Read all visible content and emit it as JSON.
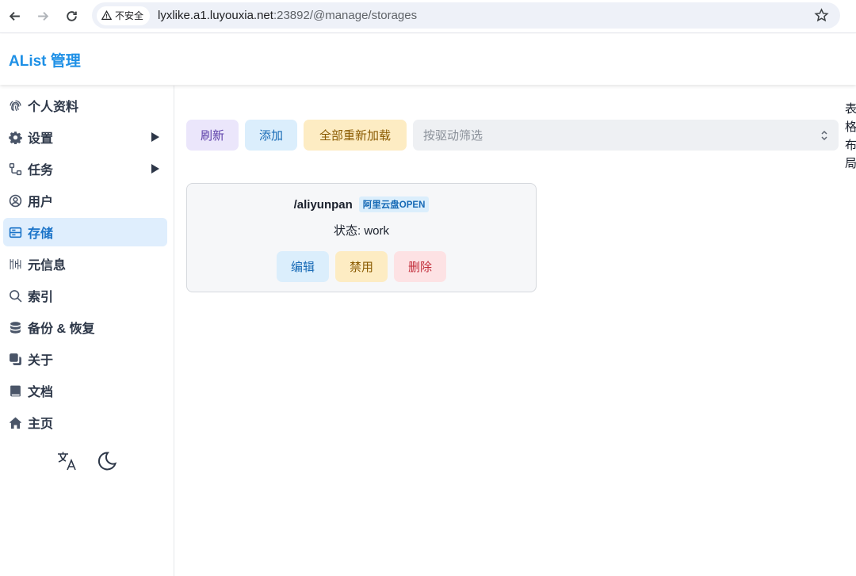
{
  "browser": {
    "security_label": "不安全",
    "url_host": "lyxlike.a1.luyouxia.net",
    "url_path": ":23892/@manage/storages"
  },
  "header": {
    "title": "AList 管理"
  },
  "sidebar": {
    "items": [
      {
        "label": "个人资料",
        "icon": "fingerprint-icon",
        "active": false,
        "expandable": false
      },
      {
        "label": "设置",
        "icon": "gear-icon",
        "active": false,
        "expandable": true
      },
      {
        "label": "任务",
        "icon": "workflow-icon",
        "active": false,
        "expandable": true
      },
      {
        "label": "用户",
        "icon": "user-circle-icon",
        "active": false,
        "expandable": false
      },
      {
        "label": "存储",
        "icon": "storage-icon",
        "active": true,
        "expandable": false
      },
      {
        "label": "元信息",
        "icon": "metadata-icon",
        "active": false,
        "expandable": false
      },
      {
        "label": "索引",
        "icon": "search-icon",
        "active": false,
        "expandable": false
      },
      {
        "label": "备份 & 恢复",
        "icon": "database-icon",
        "active": false,
        "expandable": false
      },
      {
        "label": "关于",
        "icon": "copy-icon",
        "active": false,
        "expandable": false
      },
      {
        "label": "文档",
        "icon": "book-icon",
        "active": false,
        "expandable": false
      },
      {
        "label": "主页",
        "icon": "home-icon",
        "active": false,
        "expandable": false
      }
    ],
    "tools": [
      "translate-icon",
      "moon-icon"
    ]
  },
  "toolbar": {
    "refresh_label": "刷新",
    "add_label": "添加",
    "reload_all_label": "全部重新加载",
    "driver_filter_placeholder": "按驱动筛选"
  },
  "layout_toggle": {
    "text": "表格布局"
  },
  "storages": [
    {
      "mount_path": "/aliyunpan",
      "driver": "阿里云盘OPEN",
      "status": "状态: work",
      "edit_label": "编辑",
      "disable_label": "禁用",
      "delete_label": "删除"
    }
  ],
  "colors": {
    "brand": "#1e90e6",
    "active_bg": "#dfeefd",
    "refresh_bg": "#ebe6fb",
    "add_bg": "#dbeefc",
    "reload_bg": "#fdecc3",
    "delete_bg": "#fde2e4"
  }
}
